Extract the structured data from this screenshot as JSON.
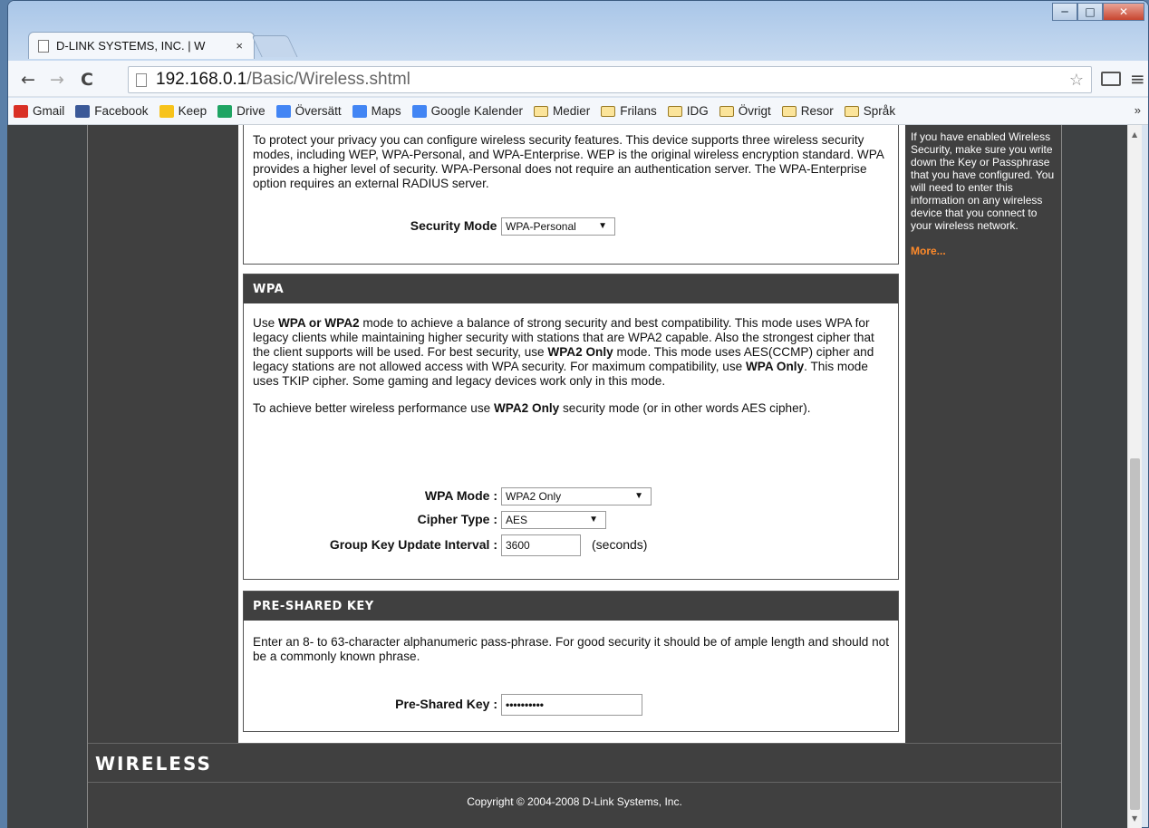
{
  "browser": {
    "tab_title": "D-LINK SYSTEMS, INC. | W",
    "tab_close": "×",
    "url_host": "192.168.0.1",
    "url_path": "/Basic/Wireless.shtml",
    "bookmarks": [
      {
        "label": "Gmail",
        "icon": "gmail-icon",
        "color": "#d93025"
      },
      {
        "label": "Facebook",
        "icon": "facebook-icon",
        "color": "#3b5998"
      },
      {
        "label": "Keep",
        "icon": "keep-icon",
        "color": "#f7c31b"
      },
      {
        "label": "Drive",
        "icon": "drive-icon",
        "color": "#1fa463"
      },
      {
        "label": "Översätt",
        "icon": "translate-icon",
        "color": "#4285f4"
      },
      {
        "label": "Maps",
        "icon": "maps-icon",
        "color": "#4285f4"
      },
      {
        "label": "Google Kalender",
        "icon": "calendar-icon",
        "color": "#4285f4"
      },
      {
        "label": "Medier",
        "icon": "folder-icon"
      },
      {
        "label": "Frilans",
        "icon": "folder-icon"
      },
      {
        "label": "IDG",
        "icon": "folder-icon"
      },
      {
        "label": "Övrigt",
        "icon": "folder-icon"
      },
      {
        "label": "Resor",
        "icon": "folder-icon"
      },
      {
        "label": "Språk",
        "icon": "folder-icon"
      }
    ],
    "bookmarks_more": "»"
  },
  "security": {
    "intro": "To protect your privacy you can configure wireless security features. This device supports three wireless security modes, including WEP, WPA-Personal, and WPA-Enterprise. WEP is the original wireless encryption standard. WPA provides a higher level of security. WPA-Personal does not require an authentication server. The WPA-Enterprise option requires an external RADIUS server.",
    "mode_label": "Security Mode :",
    "mode_value": "WPA-Personal"
  },
  "wpa": {
    "heading": "WPA",
    "p1_a": "Use ",
    "p1_b": "WPA or WPA2",
    "p1_c": " mode to achieve a balance of strong security and best compatibility. This mode uses WPA for legacy clients while maintaining higher security with stations that are WPA2 capable. Also the strongest cipher that the client supports will be used. For best security, use ",
    "p1_d": "WPA2 Only",
    "p1_e": " mode. This mode uses AES(CCMP) cipher and legacy stations are not allowed access with WPA security. For maximum compatibility, use ",
    "p1_f": "WPA Only",
    "p1_g": ". This mode uses TKIP cipher. Some gaming and legacy devices work only in this mode.",
    "p2_a": "To achieve better wireless performance use ",
    "p2_b": "WPA2 Only",
    "p2_c": " security mode (or in other words AES cipher).",
    "mode_label": "WPA Mode :",
    "mode_value": "WPA2 Only",
    "cipher_label": "Cipher Type :",
    "cipher_value": "AES",
    "interval_label": "Group Key Update Interval :",
    "interval_value": "3600",
    "interval_unit": "(seconds)"
  },
  "psk": {
    "heading": "PRE-SHARED KEY",
    "desc": "Enter an 8- to 63-character alphanumeric pass-phrase. For good security it should be of ample length and should not be a commonly known phrase.",
    "label": "Pre-Shared Key :",
    "value": "••••••••••"
  },
  "sidebar": {
    "text": "If you have enabled Wireless Security, make sure you write down the Key or Passphrase that you have configured. You will need to enter this information on any wireless device that you connect to your wireless network.",
    "more": "More..."
  },
  "footer": {
    "logo": "WIRELESS",
    "copyright": "Copyright © 2004-2008 D-Link Systems, Inc."
  }
}
